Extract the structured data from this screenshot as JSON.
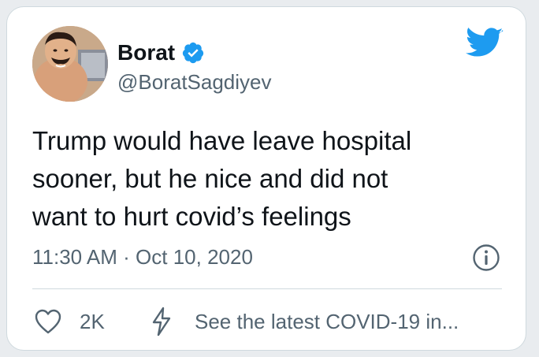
{
  "tweet": {
    "display_name": "Borat",
    "handle": "@BoratSagdiyev",
    "verified": true,
    "text_lines": [
      "Trump would have leave hospital",
      "sooner, but he nice and did not",
      "want to hurt covid’s feelings"
    ],
    "timestamp": "11:30 AM · Oct 10, 2020",
    "likes": "2K",
    "covid_link": "See the latest COVID-19 in..."
  },
  "icons": {
    "verified": "verified-badge-icon",
    "brand": "twitter-bird-icon",
    "info": "info-icon",
    "like": "heart-icon",
    "covid": "lightning-bolt-icon"
  },
  "colors": {
    "brand_blue": "#1d9bf0",
    "text": "#0f1419",
    "secondary_text": "#536471",
    "border": "#cfd9de"
  }
}
